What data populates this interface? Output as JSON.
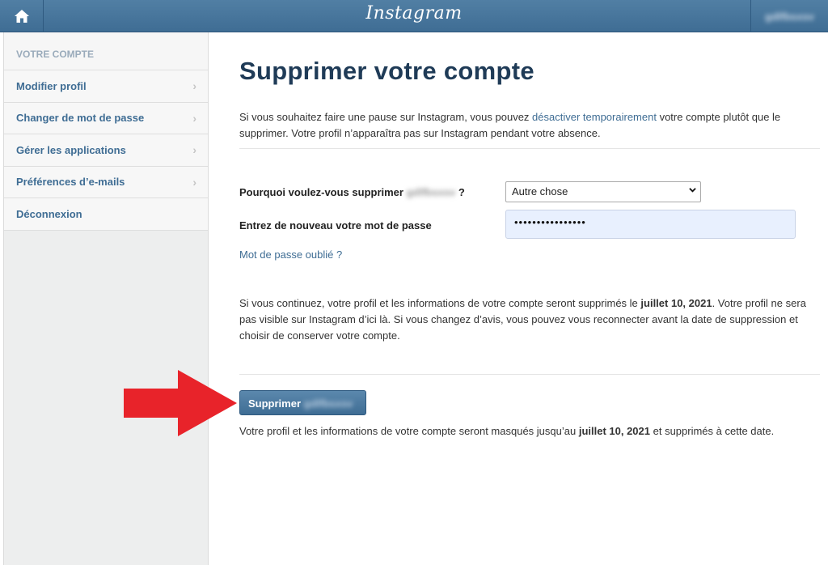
{
  "header": {
    "brand": "Instagram",
    "username": "gdlfbsxsv",
    "home_icon": "home-icon"
  },
  "sidebar": {
    "heading": "VOTRE COMPTE",
    "items": [
      {
        "label": "Modifier profil",
        "chevron": true
      },
      {
        "label": "Changer de mot de passe",
        "chevron": true
      },
      {
        "label": "Gérer les applications",
        "chevron": true
      },
      {
        "label": "Préférences d’e-mails",
        "chevron": true
      },
      {
        "label": "Déconnexion",
        "chevron": false
      }
    ]
  },
  "main": {
    "title": "Supprimer votre compte",
    "intro_before": "Si vous souhaitez faire une pause sur Instagram, vous pouvez ",
    "intro_link": "désactiver temporairement",
    "intro_after": " votre compte plutôt que le supprimer. Votre profil n’apparaîtra pas sur Instagram pendant votre absence.",
    "reason_label_before": "Pourquoi voulez-vous supprimer ",
    "reason_label_user": "gdlfbsxsv",
    "reason_label_after": " ?",
    "reason_value": "Autre chose",
    "password_label": "Entrez de nouveau votre mot de passe",
    "password_value": "••••••••••••••••",
    "forgot_link": "Mot de passe oublié ?",
    "warning_before": "Si vous continuez, votre profil et les informations de votre compte seront supprimés le ",
    "warning_date": "juillet 10, 2021",
    "warning_after": ". Votre profil ne sera pas visible sur Instagram d’ici là. Si vous changez d’avis, vous pouvez vous reconnecter avant la date de suppression et choisir de conserver votre compte.",
    "delete_button": "Supprimer",
    "delete_button_user": "gdlfbsxsv",
    "footer_before": "Votre profil et les informations de votre compte seront masqués jusqu’au ",
    "footer_date": "juillet 10, 2021",
    "footer_after": " et supprimés à cette date."
  },
  "colors": {
    "topbar": "#3f6d94",
    "link": "#3f6d94",
    "title": "#1f3b57",
    "annotation_arrow": "#e8232a"
  }
}
